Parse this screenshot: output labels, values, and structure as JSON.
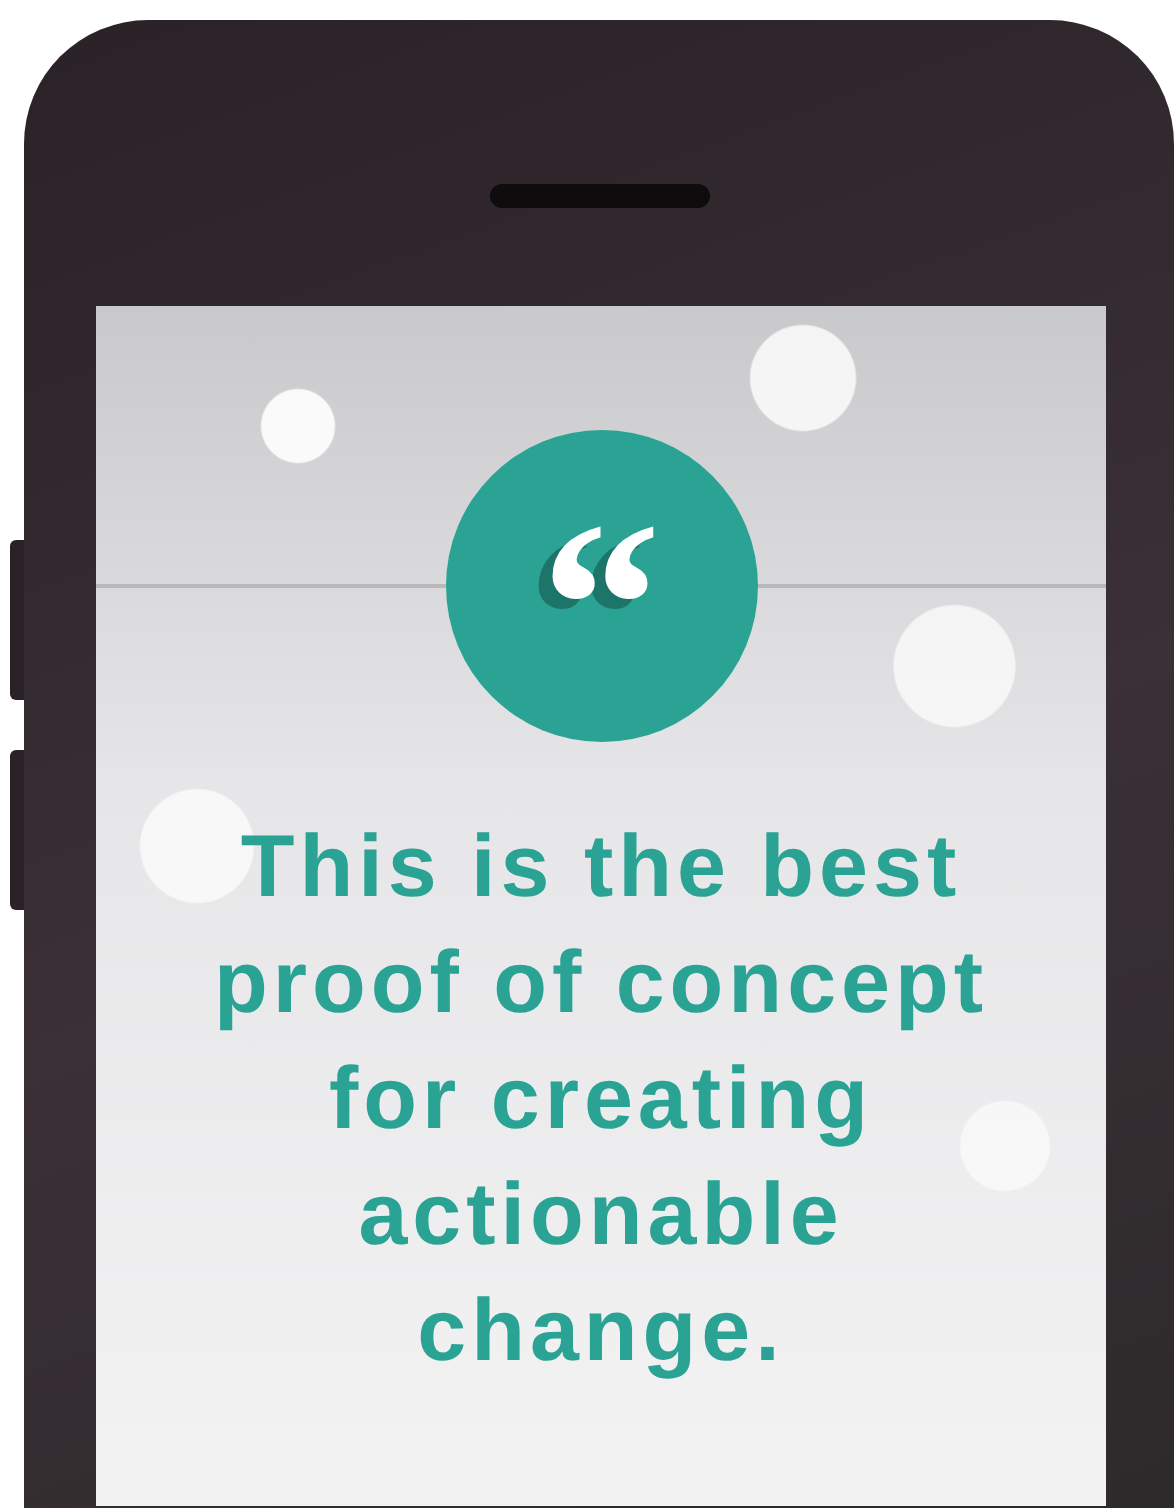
{
  "quote_icon": "“",
  "quote": "This is the best proof of concept for creating actionable change."
}
